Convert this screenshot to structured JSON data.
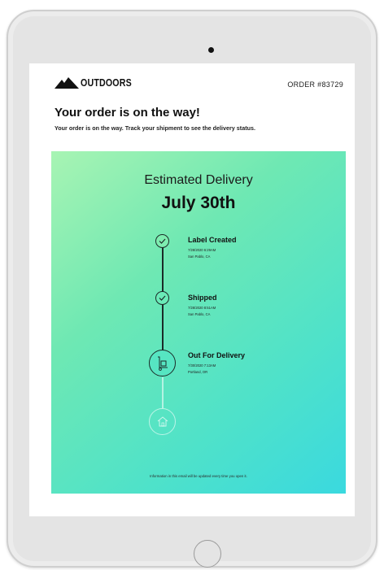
{
  "header": {
    "brand_name": "OUTDOORS",
    "order_number": "ORDER #83729"
  },
  "message": {
    "headline": "Your order is on the way!",
    "subline": "Your order is on the way. Track your shipment to see the delivery status."
  },
  "tracker": {
    "estimated_label": "Estimated Delivery",
    "estimated_date": "July 30th",
    "steps": [
      {
        "title": "Label Created",
        "time": "7/28/2020  6:29AM",
        "place": "San Pablo, CA",
        "icon": "check-icon",
        "status": "done"
      },
      {
        "title": "Shipped",
        "time": "7/28/2020  8:51AM",
        "place": "San Pablo, CA",
        "icon": "check-icon",
        "status": "done"
      },
      {
        "title": "Out For Delivery",
        "time": "7/30/2020  7:13AM",
        "place": "Portland, OR",
        "icon": "hand-truck-icon",
        "status": "current"
      },
      {
        "icon": "house-icon",
        "status": "pending"
      }
    ],
    "footer_note": "Information in this email will be updated every time you open it."
  },
  "colors": {
    "gradient_start": "#a8f4b3",
    "gradient_end": "#3ad9df",
    "line": "#1b2b28"
  }
}
